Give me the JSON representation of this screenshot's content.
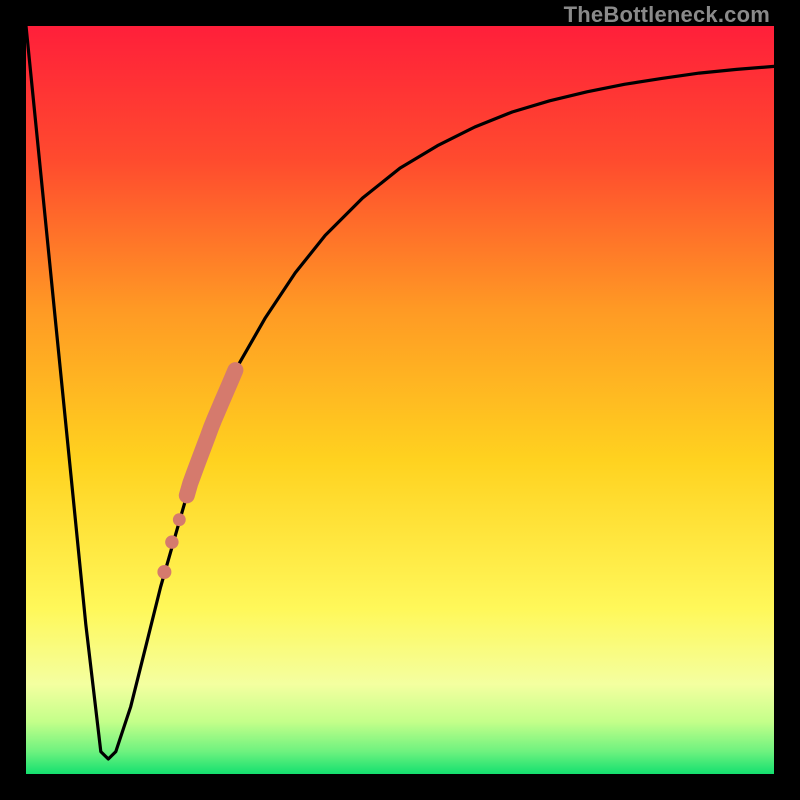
{
  "watermark": "TheBottleneck.com",
  "colors": {
    "background": "#000000",
    "gradient_top": "#ff1f3a",
    "gradient_mid_upper": "#ff7a2a",
    "gradient_mid": "#ffd21f",
    "gradient_mid_lower": "#fff85a",
    "gradient_lower": "#c9ff77",
    "gradient_bottom": "#14e06f",
    "curve": "#000000",
    "marker": "#d57a6d"
  },
  "chart_data": {
    "type": "line",
    "title": "",
    "xlabel": "",
    "ylabel": "",
    "xlim": [
      0,
      100
    ],
    "ylim": [
      0,
      100
    ],
    "grid": false,
    "legend": false,
    "series": [
      {
        "name": "bottleneck-curve",
        "x": [
          0,
          2,
          4,
          6,
          8,
          10,
          11,
          12,
          14,
          16,
          18,
          20,
          22,
          25,
          28,
          32,
          36,
          40,
          45,
          50,
          55,
          60,
          65,
          70,
          75,
          80,
          85,
          90,
          95,
          100
        ],
        "y": [
          100,
          80,
          60,
          40,
          20,
          3,
          2,
          3,
          9,
          17,
          25,
          32,
          39,
          47,
          54,
          61,
          67,
          72,
          77,
          81,
          84,
          86.5,
          88.5,
          90,
          91.2,
          92.2,
          93,
          93.7,
          94.2,
          94.6
        ]
      }
    ],
    "highlight_band": {
      "name": "highlighted-range",
      "x_range": [
        18,
        28
      ],
      "marker_points": [
        {
          "x": 18.5,
          "y": 27
        },
        {
          "x": 19.5,
          "y": 31
        },
        {
          "x": 20.5,
          "y": 34
        },
        {
          "x": 22.0,
          "y": 39
        }
      ]
    }
  }
}
